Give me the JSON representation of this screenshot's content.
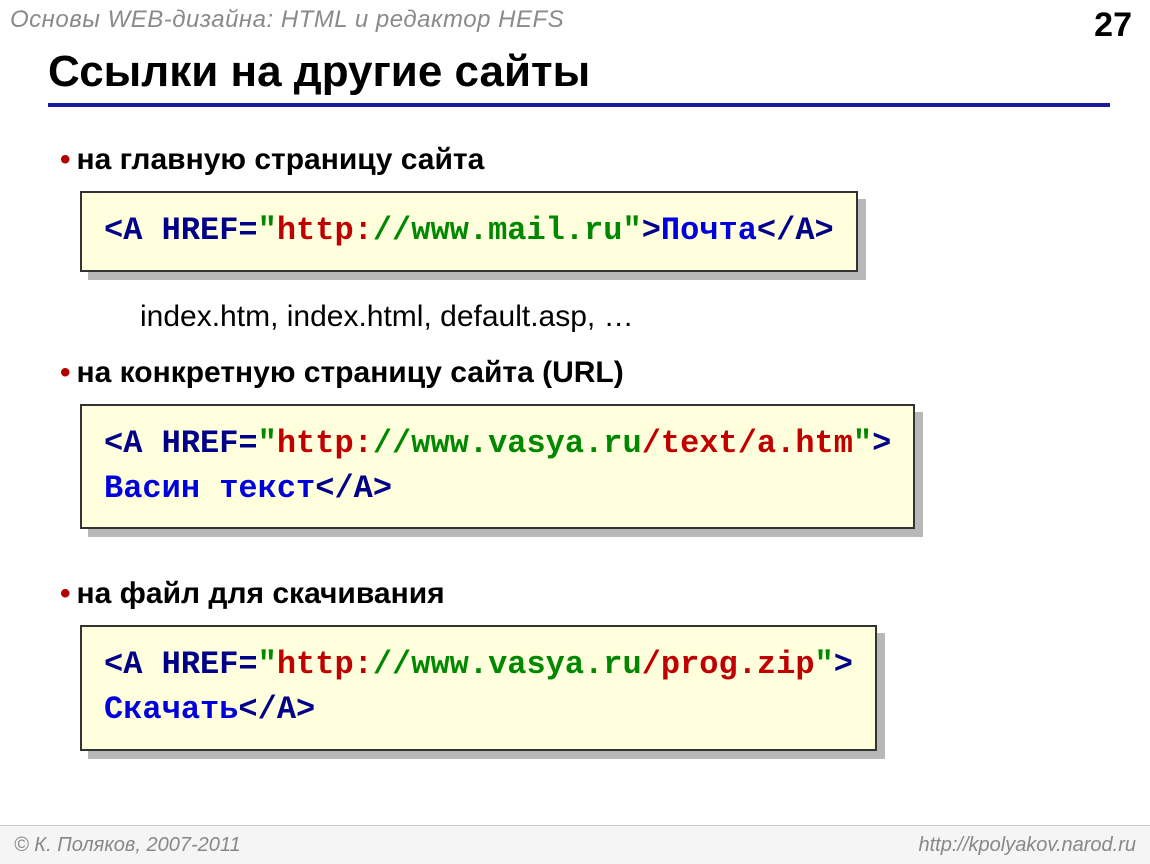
{
  "header": {
    "subject": "Основы WEB-дизайна: HTML и редактор HEFS",
    "page": "27"
  },
  "title": "Ссылки на другие сайты",
  "bullets": {
    "b1": "на главную страницу сайта",
    "b2": "на конкретную страницу сайта (URL)",
    "b3": "на файл для скачивания"
  },
  "code1": {
    "open": "<A HREF=",
    "q1": "\"",
    "scheme": "http:",
    "rest": "//www.mail.ru",
    "q2": "\"",
    "gt": ">",
    "link": "Почта",
    "close": "</A>"
  },
  "note1": "index.htm, index.html, default.asp, …",
  "code2": {
    "open": "<A HREF=",
    "q1": "\"",
    "scheme": "http:",
    "host": "//www.vasya.ru",
    "path": "/text/a.htm",
    "q2": "\"",
    "gt": ">",
    "link": "Васин текст",
    "close": "</A>"
  },
  "code3": {
    "open": "<A HREF=",
    "q1": "\"",
    "scheme": "http:",
    "host": "//www.vasya.ru",
    "path": "/prog.zip",
    "q2": "\"",
    "gt": ">",
    "link": "Скачать",
    "close": "</A>"
  },
  "footer": {
    "copyright": " К. Поляков, 2007-2011",
    "url": "http://kpolyakov.narod.ru"
  }
}
